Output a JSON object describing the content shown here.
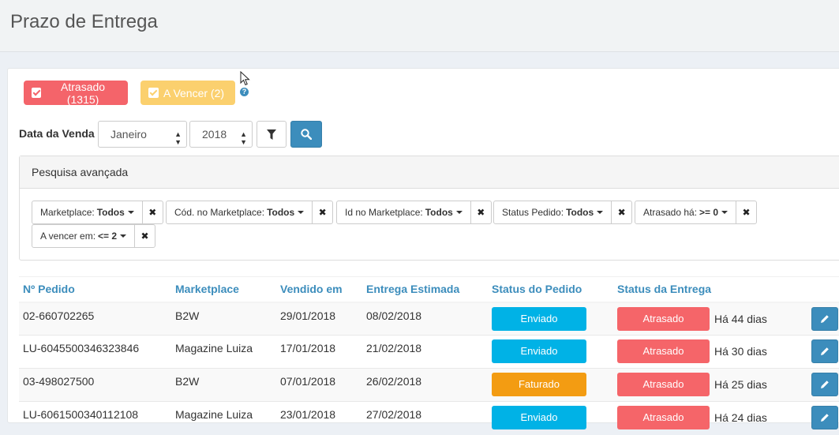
{
  "page": {
    "title": "Prazo de Entrega"
  },
  "tags": {
    "late_label": "Atrasado (1315)",
    "due_label": "A Vencer (2)",
    "help_symbol": "?"
  },
  "filters": {
    "date_label": "Data da Venda",
    "month": "Janeiro",
    "year": "2018"
  },
  "advanced": {
    "heading": "Pesquisa avançada",
    "chips": [
      {
        "label": "Marketplace:",
        "value": "Todos"
      },
      {
        "label": "Cód. no Marketplace:",
        "value": "Todos"
      },
      {
        "label": "Id no Marketplace:",
        "value": "Todos"
      },
      {
        "label": "Status Pedido:",
        "value": "Todos"
      },
      {
        "label": "Atrasado há:",
        "value": ">= 0"
      },
      {
        "label": "A vencer em:",
        "value": "<= 2"
      }
    ]
  },
  "table": {
    "headers": [
      "Nº Pedido",
      "Marketplace",
      "Vendido em",
      "Entrega Estimada",
      "Status do Pedido",
      "Status da Entrega"
    ],
    "rows": [
      {
        "order": "02-660702265",
        "marketplace": "B2W",
        "sold": "29/01/2018",
        "estimated": "08/02/2018",
        "order_status": "Enviado",
        "delivery_status": "Atrasado",
        "delay": "Há 44 dias"
      },
      {
        "order": "LU-6045500346323846",
        "marketplace": "Magazine Luiza",
        "sold": "17/01/2018",
        "estimated": "21/02/2018",
        "order_status": "Enviado",
        "delivery_status": "Atrasado",
        "delay": "Há 30 dias"
      },
      {
        "order": "03-498027500",
        "marketplace": "B2W",
        "sold": "07/01/2018",
        "estimated": "26/02/2018",
        "order_status": "Faturado",
        "delivery_status": "Atrasado",
        "delay": "Há 25 dias"
      },
      {
        "order": "LU-6061500340112108",
        "marketplace": "Magazine Luiza",
        "sold": "23/01/2018",
        "estimated": "27/02/2018",
        "order_status": "Enviado",
        "delivery_status": "Atrasado",
        "delay": "Há 24 dias"
      }
    ]
  },
  "colors": {
    "late": "#f4646a",
    "due": "#fbd06e",
    "sent": "#00b2e6",
    "billed": "#f39c12",
    "primary": "#3c8dbc"
  },
  "icons": {
    "tag_check": "check-square-icon",
    "help": "question-circle-icon",
    "filter": "filter-icon",
    "search": "search-icon",
    "remove": "times-icon",
    "edit": "pencil-icon",
    "cursor": "mouse-pointer-icon"
  }
}
